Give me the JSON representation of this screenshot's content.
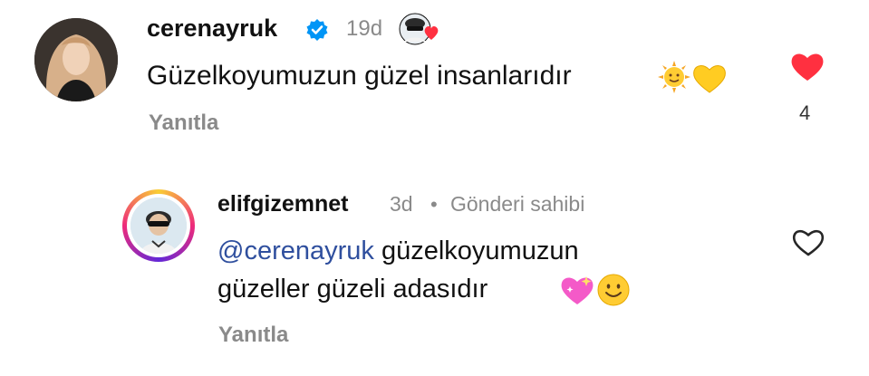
{
  "comments": [
    {
      "username": "cerenayruk",
      "verified": true,
      "time": "19d",
      "text": "Güzelkoyumuzun güzel insanlarıdır",
      "emojis": [
        "sun-with-face-emoji",
        "yellow-heart-emoji"
      ],
      "reply_label": "Yanıtla",
      "liked": true,
      "like_count": "4",
      "liked_by_author_icon": "author-like-avatar-with-heart"
    },
    {
      "username": "elifgizemnet",
      "time": "3d",
      "separator": "•",
      "owner_label": "Gönderi sahibi",
      "mention": "@cerenayruk",
      "text_line1": " güzelkoyumuzun",
      "text_line2": "güzeller güzeli adasıdır",
      "emojis": [
        "sparkling-heart-emoji",
        "smiling-face-emoji"
      ],
      "reply_label": "Yanıtla",
      "liked": false
    }
  ],
  "colors": {
    "like_red": "#ff3040",
    "verified_blue": "#0095f6",
    "mention_blue": "#2f4f9e",
    "muted_gray": "#8a8a8a"
  }
}
